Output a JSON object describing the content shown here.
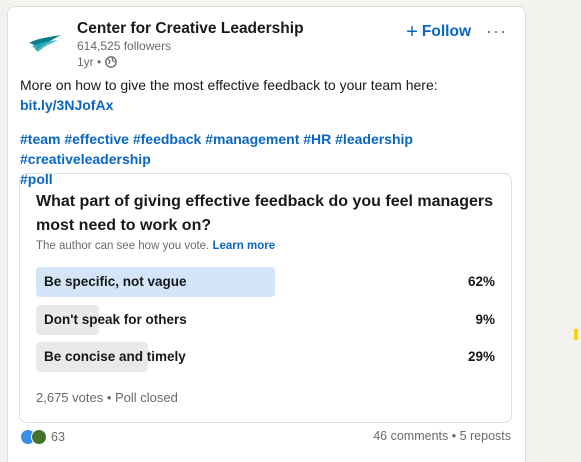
{
  "post": {
    "author_name": "Center for Creative Leadership",
    "followers": "614,525 followers",
    "time": "1yr •",
    "follow_label": "Follow",
    "follow_plus": "+",
    "more_label": "···",
    "body_text": "More on how to give the most effective feedback to your team here:",
    "link_text": "bit.ly/3NJofAx",
    "hashtags_line1": "#team #effective #feedback #management #HR #leadership #creativeleadership",
    "hashtags_line2": "#poll"
  },
  "poll": {
    "question": "What part of giving effective feedback do you feel managers most need to work on?",
    "note": "The author can see how you vote.",
    "learn_more": "Learn more",
    "options": [
      {
        "label": "Be specific, not vague",
        "percent_text": "62%",
        "percent": 62,
        "selected": true
      },
      {
        "label": "Don't speak for others",
        "percent_text": "9%",
        "percent": 9,
        "selected": false
      },
      {
        "label": "Be concise and timely",
        "percent_text": "29%",
        "percent": 29,
        "selected": false
      }
    ],
    "status": "2,675 votes • Poll closed"
  },
  "social": {
    "reaction_count": "63",
    "comments_reposts": "46 comments • 5 reposts"
  },
  "colors": {
    "accent": "#0a66c2",
    "selected_bar": "#d5e5f9",
    "unselected_bar": "#e9e9e9"
  }
}
